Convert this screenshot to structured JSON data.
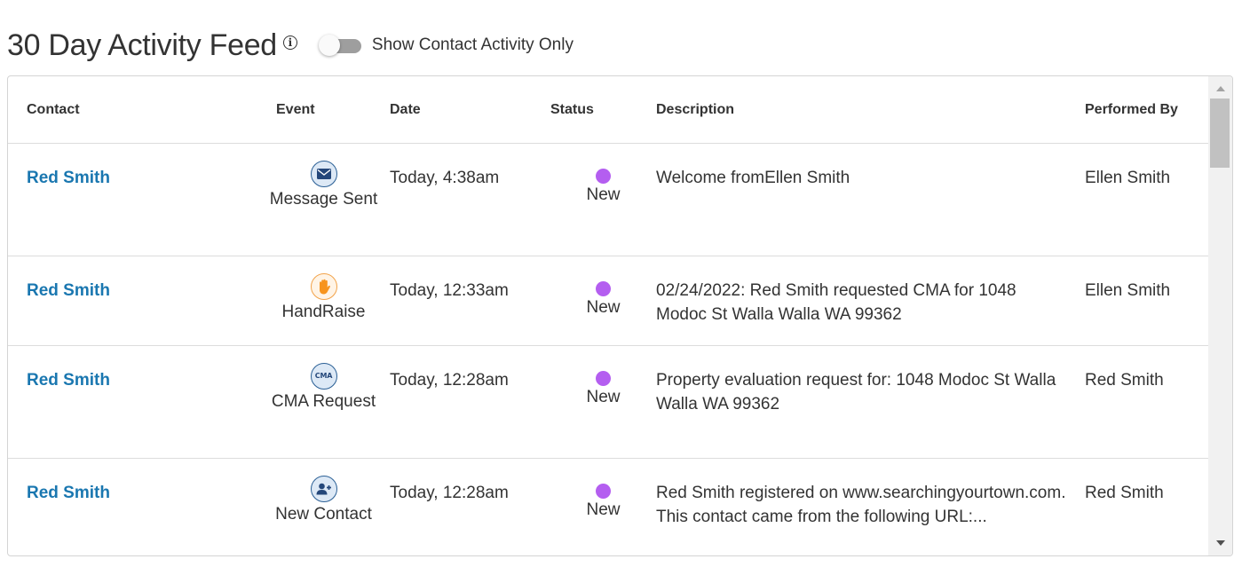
{
  "header": {
    "title": "30 Day Activity Feed",
    "info_icon": "info-circle-icon",
    "toggle_label": "Show Contact Activity Only",
    "toggle_on": false
  },
  "table": {
    "columns": [
      "Contact",
      "Event",
      "Date",
      "Status",
      "Description",
      "Performed By"
    ],
    "rows": [
      {
        "contact": "Red Smith",
        "event_icon": "envelope-icon",
        "event": "Message Sent",
        "date": "Today, 4:38am",
        "status": "New",
        "description": "Welcome fromEllen Smith",
        "performed_by": "Ellen Smith"
      },
      {
        "contact": "Red Smith",
        "event_icon": "raised-hand-icon",
        "event": "HandRaise",
        "date": "Today, 12:33am",
        "status": "New",
        "description": "02/24/2022: Red Smith requested CMA for 1048 Modoc St Walla Walla WA 99362",
        "performed_by": "Ellen Smith"
      },
      {
        "contact": "Red Smith",
        "event_icon": "cma-icon",
        "event_icon_text": "CMA",
        "event": "CMA Request",
        "date": "Today, 12:28am",
        "status": "New",
        "description": "Property evaluation request for: 1048 Modoc St Walla Walla WA 99362",
        "performed_by": "Red Smith"
      },
      {
        "contact": "Red Smith",
        "event_icon": "add-user-icon",
        "event": "New Contact",
        "date": "Today, 12:28am",
        "status": "New",
        "description": "Red Smith registered on www.searchingyourtown.com. This contact came from the following URL:...",
        "performed_by": "Red Smith"
      }
    ]
  },
  "colors": {
    "link": "#1a77b0",
    "status_new": "#b45ef0",
    "icon_blue": "#24477a",
    "icon_orange": "#f7941d"
  }
}
